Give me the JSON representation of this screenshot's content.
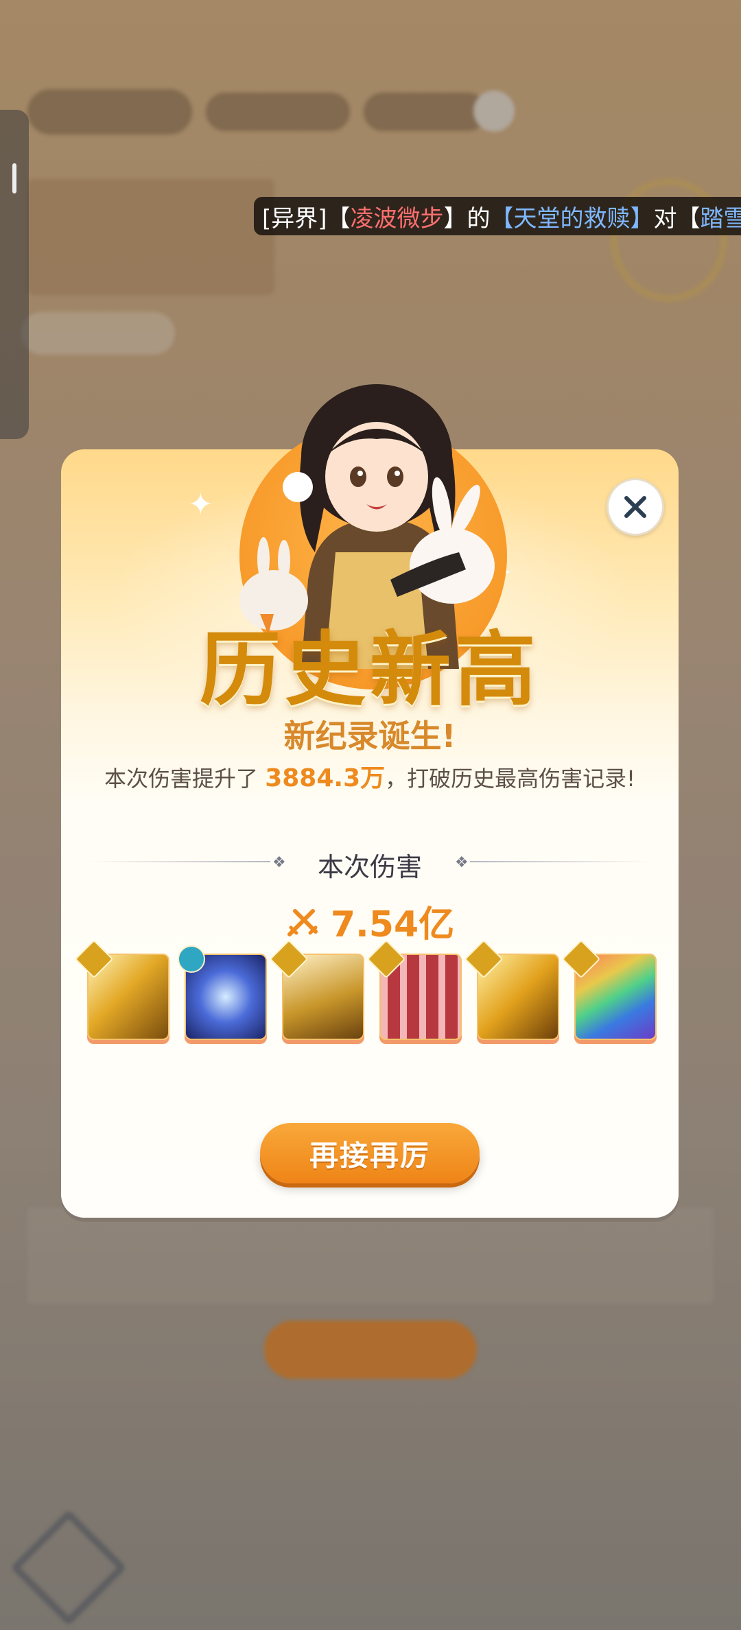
{
  "marquee": {
    "prefix": "[异界]【",
    "skill_name": "凌波微步",
    "mid1": "】的",
    "target_name": "【天堂的救赎】",
    "mid2": "对【",
    "tail": "踏雪"
  },
  "modal": {
    "title": "历史新高",
    "subtitle": "新纪录诞生!",
    "desc_before": "本次伤害提升了",
    "desc_value": "3884.3万",
    "desc_after": "，打破历史最高伤害记录!",
    "section_title": "本次伤害",
    "damage_value": "7.54亿",
    "retry_label": "再接再厉"
  },
  "skills": [
    {
      "name": "skill-1",
      "badge": "sword"
    },
    {
      "name": "skill-2",
      "badge": "swirl"
    },
    {
      "name": "skill-3",
      "badge": "sword"
    },
    {
      "name": "skill-4",
      "badge": "sword"
    },
    {
      "name": "skill-5",
      "badge": "sword"
    },
    {
      "name": "skill-6",
      "badge": "sword"
    }
  ],
  "colors": {
    "accent": "#ee8a1e",
    "title": "#d48a0a",
    "button": "#f39a2a"
  },
  "icons": {
    "close": "close-icon",
    "damage": "crossed-swords-icon",
    "divider": "diamond-icon"
  }
}
